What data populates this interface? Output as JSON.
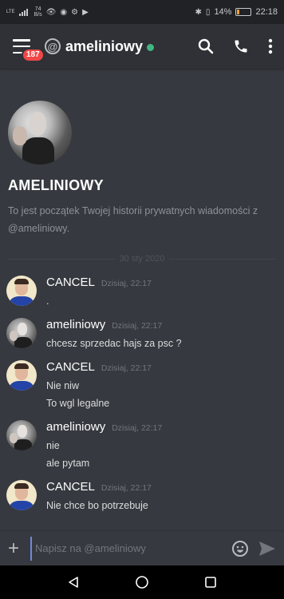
{
  "status_bar": {
    "network": "LTE",
    "speed_value": "74",
    "speed_unit": "B/s",
    "battery_percent": "14%",
    "battery_level": 0.14,
    "time": "22:18"
  },
  "header": {
    "unread_badge": "187",
    "at_symbol": "@",
    "username": "ameliniowy",
    "status_color": "#43b581"
  },
  "intro": {
    "name": "AMELINIOWY",
    "description": "To jest początek Twojej historii prywatnych wiadomości z @ameliniowy."
  },
  "date_divider": "30 sty 2020",
  "messages": [
    {
      "author": "CANCEL",
      "time": "Dzisiaj, 22:17",
      "avatar": "cancel",
      "lines": [
        "."
      ]
    },
    {
      "author": "ameliniowy",
      "time": "Dzisiaj, 22:17",
      "avatar": "amel",
      "lines": [
        "chcesz sprzedac hajs za psc ?"
      ]
    },
    {
      "author": "CANCEL",
      "time": "Dzisiaj, 22:17",
      "avatar": "cancel",
      "lines": [
        "Nie niw",
        "To wgl legalne"
      ]
    },
    {
      "author": "ameliniowy",
      "time": "Dzisiaj, 22:17",
      "avatar": "amel",
      "lines": [
        "nie",
        "ale pytam"
      ]
    },
    {
      "author": "CANCEL",
      "time": "Dzisiaj, 22:17",
      "avatar": "cancel",
      "lines": [
        "Nie chce bo potrzebuje"
      ]
    }
  ],
  "composer": {
    "plus_label": "+",
    "placeholder": "Napisz na @ameliniowy"
  },
  "icons": {
    "menu": "hamburger-icon",
    "search": "search-icon",
    "call": "phone-icon",
    "more": "more-vertical-icon",
    "emoji": "emoji-icon",
    "send": "send-icon",
    "back": "back-triangle-icon",
    "home": "home-circle-icon",
    "recents": "recents-square-icon"
  },
  "colors": {
    "background": "#36393f",
    "header": "#2f3136",
    "badge": "#f04747",
    "online": "#43b581",
    "accent": "#7289da"
  }
}
